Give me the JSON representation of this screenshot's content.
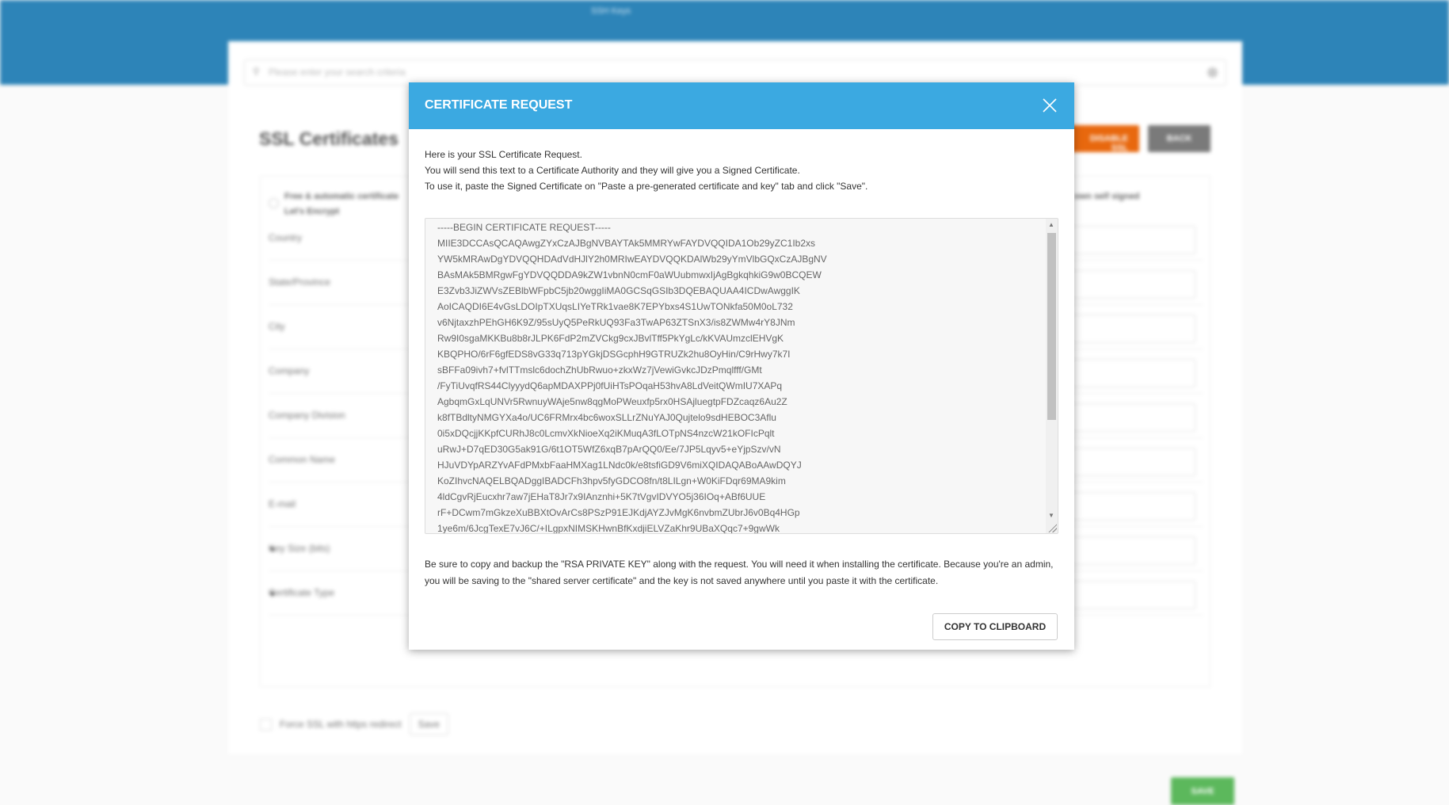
{
  "header": {
    "breadcrumb": "SSH Keys"
  },
  "search": {
    "placeholder": "Please enter your search criteria"
  },
  "page": {
    "title": "SSL Certificates",
    "disable_ssl_label": "DISABLE SSL",
    "back_label": "BACK",
    "option_left": "Free & automatic certificate\nLet's Encrypt",
    "option_right": "your own self signed\ncate",
    "fields": [
      "Country",
      "State/Province",
      "City",
      "Company",
      "Company Division",
      "Common Name",
      "E-mail",
      "Key Size (bits)",
      "Certificate Type"
    ],
    "save_label": "SAVE",
    "force_ssl_label": "Force SSL with https redirect",
    "force_save_label": "Save"
  },
  "modal": {
    "title": "CERTIFICATE REQUEST",
    "intro": [
      "Here is your SSL Certificate Request.",
      "You will send this text to a Certificate Authority and they will give you a Signed Certificate.",
      "To use it, paste the Signed Certificate on \"Paste a pre-generated certificate and key\" tab and click \"Save\"."
    ],
    "csr": "-----BEGIN CERTIFICATE REQUEST-----\nMIIE3DCCAsQCAQAwgZYxCzAJBgNVBAYTAk5MMRYwFAYDVQQIDA1Ob29yZC1Ib2xs\nYW5kMRAwDgYDVQQHDAdVdHJlY2h0MRIwEAYDVQQKDAlWb29yYmVlbGQxCzAJBgNV\nBAsMAk5BMRgwFgYDVQQDDA9kZW1vbnN0cmF0aWUubmwxIjAgBgkqhkiG9w0BCQEW\nE3Zvb3JiZWVsZEBlbWFpbC5jb20wggIiMA0GCSqGSIb3DQEBAQUAA4ICDwAwggIK\nAoICAQDI6E4vGsLDOIpTXUqsLIYeTRk1vae8K7EPYbxs4S1UwTONkfa50M0oL732\nv6NjtaxzhPEhGH6K9Z/95sUyQ5PeRkUQ93Fa3TwAP63ZTSnX3/is8ZWMw4rY8JNm\nRw9I0sgaMKKBu8b8rJLPK6FdP2mZVCkg9cxJBvlTff5PkYgLc/kKVAUmzclEHVgK\nKBQPHO/6rF6gfEDS8vG33q713pYGkjDSGcphH9GTRUZk2hu8OyHin/C9rHwy7k7I\nsBFFa09ivh7+fvlTTmslc6dochZhUbRwuo+zkxWz7jVewiGvkcJDzPmqlfff/GMt\n/FyTiUvqfRS44ClyyydQ6apMDAXPPj0fUiHTsPOqaH53hvA8LdVeitQWmIU7XAPq\nAgbqmGxLqUNVr5RwnuyWAje5nw8qgMoPWeuxfp5rx0HSAjluegtpFDZcaqz6Au2Z\nk8fTBdltyNMGYXa4o/UC6FRMrx4bc6woxSLLrZNuYAJ0Qujtelo9sdHEBOC3Aflu\n0i5xDQcjjKKpfCURhJ8c0LcmvXkNioeXq2iKMuqA3fLOTpNS4nzcW21kOFIcPqlt\nuRwJ+D7qED30G5ak91G/6t1OT5WfZ6xqB7pArQQ0/Ee/7JP5Lqyv5+eYjpSzv/vN\nHJuVDYpARZYvAFdPMxbFaaHMXag1LNdc0k/e8tsfiGD9V6miXQIDAQABoAAwDQYJ\nKoZIhvcNAQELBQADggIBADCFh3hpv5fyGDCO8fn/t8LILgn+W0KiFDqr69MA9kim\n4ldCgvRjEucxhr7aw7jEHaT8Jr7x9IAnznhi+5K7tVgvIDVYO5j36IOq+ABf6UUE\nrF+DCwm7mGkzeXuBBXtOvArCs8PSzP91EJKdjAYZJvMgK6nvbmZUbrJ6v0Bq4HGp\n1ye6m/6JcgTexE7vJ6C/+ILgpxNIMSKHwnBfKxdjiELVZaKhr9UBaXQqc7+9gwWk",
    "note": "Be sure to copy and backup the \"RSA PRIVATE KEY\" along with the request. You will need it when installing the certificate. Because you're an admin, you will be saving to the \"shared server certificate\" and the key is not saved anywhere until you paste it with the certificate.",
    "copy_label": "COPY TO CLIPBOARD"
  },
  "colors": {
    "header": "#2d84b8",
    "modal_header": "#3ba9e1",
    "disable": "#e8680e",
    "back": "#7a7a7a",
    "save": "#5cb85c"
  },
  "icons": {
    "search": "search-icon",
    "close": "close-icon",
    "dropdown": "caret-down-icon"
  }
}
